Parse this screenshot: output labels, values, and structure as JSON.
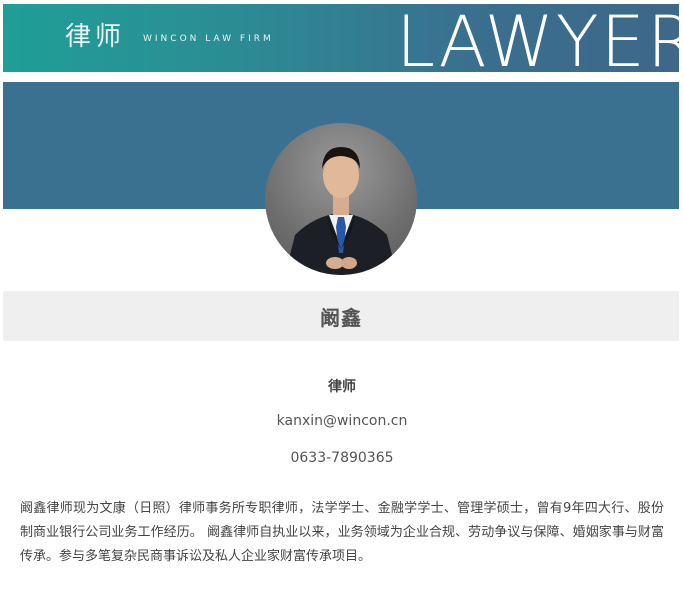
{
  "banner": {
    "cn_title": "律师",
    "en_firm": "WINCON LAW FIRM",
    "big_word": "LAWYER"
  },
  "profile": {
    "name": "阚鑫",
    "title": "律师",
    "email": "kanxin@wincon.cn",
    "phone": "0633-7890365",
    "bio": "阚鑫律师现为文康（日照）律师事务所专职律师，法学学士、金融学学士、管理学硕士，曾有9年四大行、股份制商业银行公司业务工作经历。 阚鑫律师自执业以来，业务领域为企业合规、劳动争议与保障、婚姻家事与财富传承。参与多笔复杂民商事诉讼及私人企业家财富传承项目。"
  },
  "colors": {
    "banner_start": "#1f9e96",
    "banner_end": "#3e6789",
    "header_block": "#3a7191",
    "name_bar": "#efefef"
  }
}
